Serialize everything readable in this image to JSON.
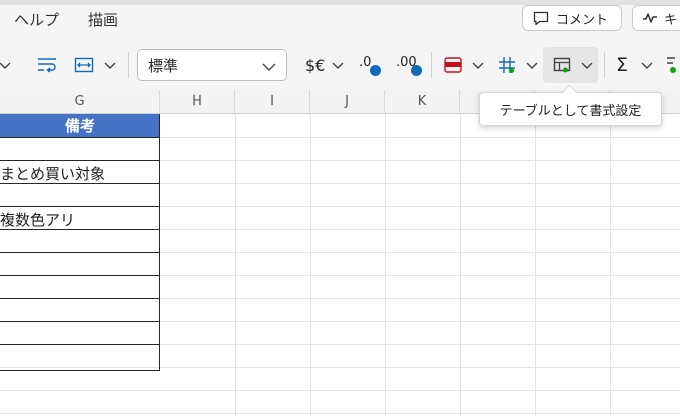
{
  "menu": {
    "help": "ヘルプ",
    "draw": "描画"
  },
  "header_buttons": {
    "comment": "コメント",
    "catchup": "キ"
  },
  "toolbar": {
    "number_format": "標準",
    "currency_symbol": "$€",
    "decrease_decimal": ".0",
    "increase_decimal": ".00",
    "sum_symbol": "Σ"
  },
  "tooltip": "テーブルとして書式設定",
  "columns": [
    "G",
    "H",
    "I",
    "J",
    "K"
  ],
  "table": {
    "header": "備考",
    "rows": [
      "",
      "まとめ買い対象",
      "",
      "複数色アリ",
      "",
      "",
      "",
      "",
      "",
      ""
    ]
  },
  "colors": {
    "table_header": "#4472c4",
    "accent_blue": "#0f6cbd",
    "accent_red": "#c50f1f",
    "accent_green": "#13a10e"
  }
}
